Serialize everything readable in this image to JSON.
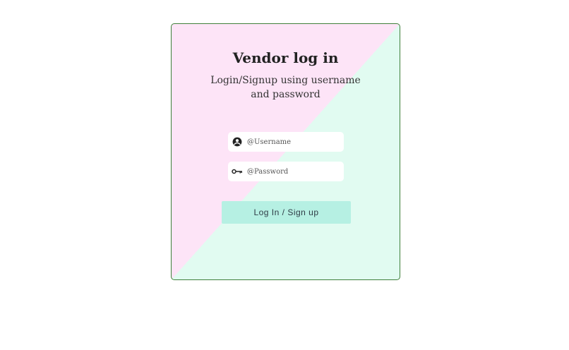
{
  "login": {
    "title": "Vendor log in",
    "subtitle": "Login/Signup using username and password",
    "username_placeholder": "@Username",
    "password_placeholder": "@Password",
    "submit_label": "Log In / Sign up"
  },
  "icons": {
    "username": "account-circle-icon",
    "password": "key-icon"
  },
  "colors": {
    "card_border": "#3f7f3a",
    "bg_pink": "#fde4f7",
    "bg_mint": "#e1fbf1",
    "button": "#b6f0e3"
  }
}
